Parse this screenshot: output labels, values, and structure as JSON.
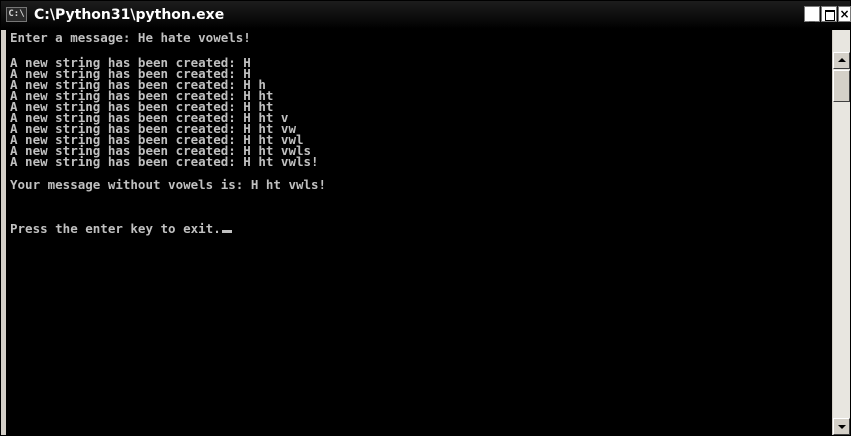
{
  "window": {
    "title": "C:\\Python31\\python.exe",
    "icon_text": "C:\\",
    "minimize_glyph": "_",
    "close_glyph": "×"
  },
  "console": {
    "lines": [
      "Enter a message: He hate vowels!",
      "",
      "A new string has been created: H",
      "A new string has been created: H",
      "A new string has been created: H h",
      "A new string has been created: H ht",
      "A new string has been created: H ht",
      "A new string has been created: H ht v",
      "A new string has been created: H ht vw",
      "A new string has been created: H ht vwl",
      "A new string has been created: H ht vwls",
      "A new string has been created: H ht vwls!",
      "",
      "Your message without vowels is: H ht vwls!",
      "",
      "",
      "Press the enter key to exit."
    ],
    "text_color": "#c0c0c0",
    "background": "#000000"
  },
  "icons": {
    "system": "console-window-icon",
    "minimize": "minimize-icon",
    "maximize": "maximize-icon",
    "close": "close-icon",
    "scroll_up": "arrow-up-icon",
    "scroll_down": "arrow-down-icon"
  }
}
